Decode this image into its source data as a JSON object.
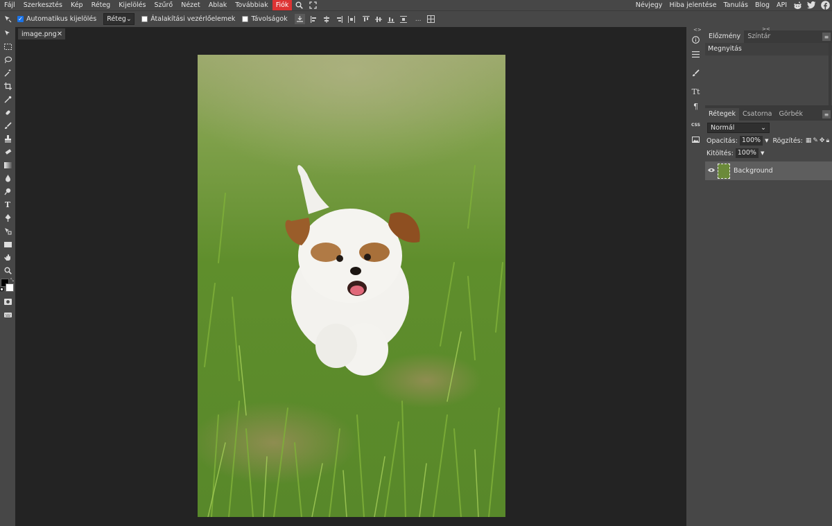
{
  "menu": {
    "items": [
      "Fájl",
      "Szerkesztés",
      "Kép",
      "Réteg",
      "Kijelölés",
      "Szűrő",
      "Nézet",
      "Ablak",
      "Továbbiak"
    ],
    "account": "Fiók",
    "right_items": [
      "Névjegy",
      "Hiba jelentése",
      "Tanulás",
      "Blog",
      "API"
    ]
  },
  "options": {
    "auto_select_label": "Automatikus kijelölés",
    "auto_select_checked": true,
    "layer_select_value": "Réteg",
    "transform_controls_label": "Átalakítási vezérlőelemek",
    "distances_label": "Távolságok",
    "more": "..."
  },
  "document": {
    "tab_name": "image.png"
  },
  "history_panel": {
    "tabs": [
      "Előzmény",
      "Színtár"
    ],
    "entries": [
      "Megnyitás"
    ]
  },
  "layers_panel": {
    "tabs": [
      "Rétegek",
      "Csatorna",
      "Görbék"
    ],
    "blend_mode": "Normál",
    "opacity_label": "Opacitás:",
    "opacity_value": "100%",
    "lock_label": "Rögzítés:",
    "fill_label": "Kitöltés:",
    "fill_value": "100%",
    "layers": [
      {
        "name": "Background",
        "visible": true
      }
    ]
  },
  "colors": {
    "foreground": "#000000",
    "background": "#ffffff",
    "account_red": "#dd3333",
    "panel": "#474747",
    "workspace": "#232323"
  }
}
